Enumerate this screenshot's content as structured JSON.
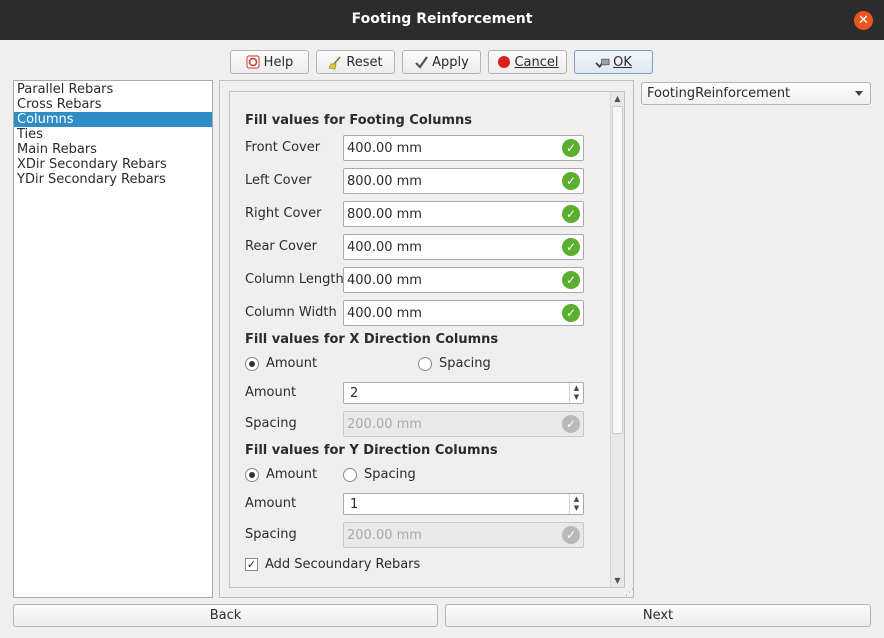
{
  "window": {
    "title": "Footing Reinforcement"
  },
  "toolbar": {
    "help_label": "Help",
    "reset_label": "Reset",
    "apply_label": "Apply",
    "cancel_label": "Cancel",
    "ok_label": "OK"
  },
  "sidebar": {
    "items": [
      {
        "label": "Parallel Rebars"
      },
      {
        "label": "Cross Rebars"
      },
      {
        "label": "Columns",
        "selected": true
      },
      {
        "label": "Ties"
      },
      {
        "label": "Main Rebars"
      },
      {
        "label": "XDir Secondary Rebars"
      },
      {
        "label": "YDir Secondary Rebars"
      }
    ]
  },
  "form": {
    "footing_section_title": "Fill values for Footing Columns",
    "front_cover": {
      "label": "Front Cover",
      "value": "400.00 mm"
    },
    "left_cover": {
      "label": "Left Cover",
      "value": "800.00 mm"
    },
    "right_cover": {
      "label": "Right Cover",
      "value": "800.00 mm"
    },
    "rear_cover": {
      "label": "Rear Cover",
      "value": "400.00 mm"
    },
    "column_length": {
      "label": "Column Length",
      "value": "400.00 mm"
    },
    "column_width": {
      "label": "Column Width",
      "value": "400.00 mm"
    },
    "x_section_title": "Fill values for X Direction Columns",
    "x_radio_amount": "Amount",
    "x_radio_spacing": "Spacing",
    "x_amount": {
      "label": "Amount",
      "value": "2"
    },
    "x_spacing": {
      "label": "Spacing",
      "value": "200.00 mm"
    },
    "y_section_title": "Fill values for Y Direction Columns",
    "y_radio_amount": "Amount",
    "y_radio_spacing": "Spacing",
    "y_amount": {
      "label": "Amount",
      "value": "1"
    },
    "y_spacing": {
      "label": "Spacing",
      "value": "200.00 mm"
    },
    "add_secondary_label": "Add Secoundary Rebars",
    "add_secondary_checked": true
  },
  "object_selector": {
    "value": "FootingReinforcement"
  },
  "nav": {
    "back_label": "Back",
    "next_label": "Next"
  },
  "colors": {
    "accent": "#308cc6",
    "close": "#e95420",
    "valid": "#5cae2e"
  }
}
